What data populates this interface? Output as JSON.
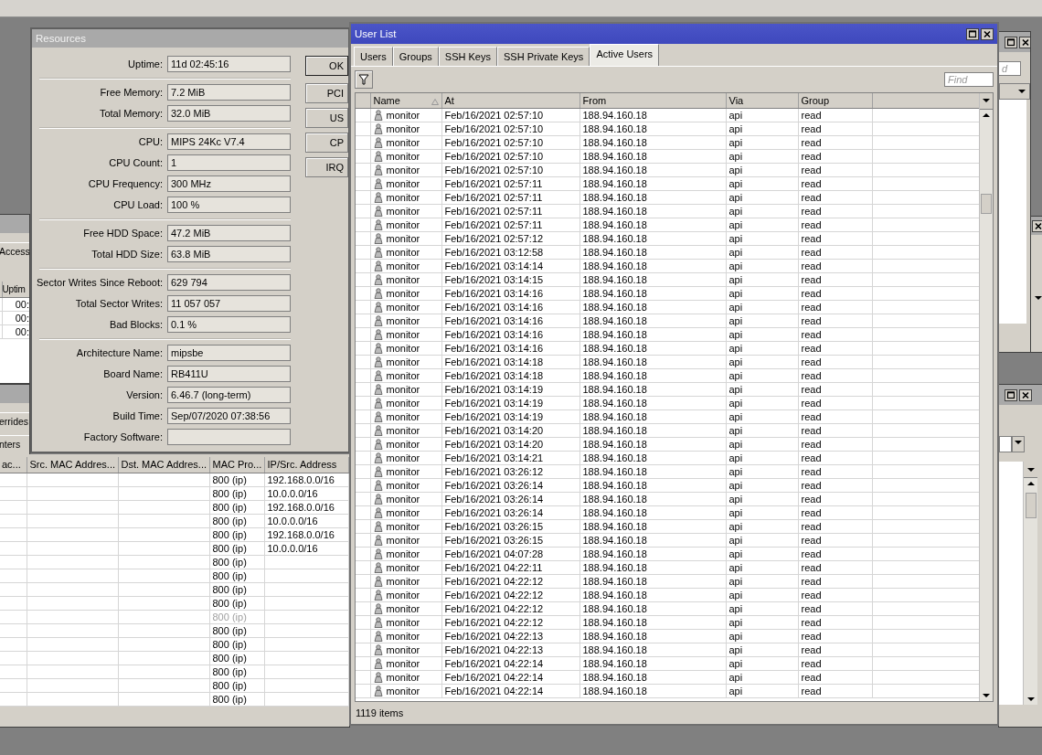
{
  "background_windows": {
    "left_top": {
      "tab": "Access",
      "column": "Uptim",
      "cells": [
        "00:",
        "00:",
        "00:"
      ]
    },
    "left_bottom": {
      "tabs": [
        "errides",
        "nters"
      ],
      "columns": [
        "ac...",
        "Src. MAC Addres...",
        "Dst. MAC Addres...",
        "MAC Pro...",
        "IP/Src. Address"
      ],
      "rows": [
        {
          "mac_protocol": "800 (ip)",
          "ip_src_address": "192.168.0.0/16",
          "disabled": false
        },
        {
          "mac_protocol": "800 (ip)",
          "ip_src_address": "10.0.0.0/16",
          "disabled": false
        },
        {
          "mac_protocol": "800 (ip)",
          "ip_src_address": "192.168.0.0/16",
          "disabled": false
        },
        {
          "mac_protocol": "800 (ip)",
          "ip_src_address": "10.0.0.0/16",
          "disabled": false
        },
        {
          "mac_protocol": "800 (ip)",
          "ip_src_address": "192.168.0.0/16",
          "disabled": false
        },
        {
          "mac_protocol": "800 (ip)",
          "ip_src_address": "10.0.0.0/16",
          "disabled": false
        },
        {
          "mac_protocol": "800 (ip)",
          "disabled": false
        },
        {
          "mac_protocol": "800 (ip)",
          "disabled": false
        },
        {
          "mac_protocol": "800 (ip)",
          "disabled": false
        },
        {
          "mac_protocol": "800 (ip)",
          "disabled": false
        },
        {
          "mac_protocol": "800 (ip)",
          "disabled": true
        },
        {
          "mac_protocol": "800 (ip)",
          "disabled": false
        },
        {
          "mac_protocol": "800 (ip)",
          "disabled": false
        },
        {
          "mac_protocol": "800 (ip)",
          "disabled": false
        },
        {
          "mac_protocol": "800 (ip)",
          "disabled": false
        },
        {
          "mac_protocol": "800 (ip)",
          "disabled": false
        },
        {
          "mac_protocol": "800 (ip)",
          "disabled": false
        }
      ]
    },
    "right_top": {
      "find_placeholder": "d"
    }
  },
  "resources": {
    "title": "Resources",
    "groups": [
      [
        {
          "label": "Uptime:",
          "value": "11d 02:45:16"
        }
      ],
      [
        {
          "label": "Free Memory:",
          "value": "7.2 MiB"
        },
        {
          "label": "Total Memory:",
          "value": "32.0 MiB"
        }
      ],
      [
        {
          "label": "CPU:",
          "value": "MIPS 24Kc V7.4"
        },
        {
          "label": "CPU Count:",
          "value": "1"
        },
        {
          "label": "CPU Frequency:",
          "value": "300 MHz"
        },
        {
          "label": "CPU Load:",
          "value": "100 %"
        }
      ],
      [
        {
          "label": "Free HDD Space:",
          "value": "47.2 MiB"
        },
        {
          "label": "Total HDD Size:",
          "value": "63.8 MiB"
        }
      ],
      [
        {
          "label": "Sector Writes Since Reboot:",
          "value": "629 794"
        },
        {
          "label": "Total Sector Writes:",
          "value": "11 057 057"
        },
        {
          "label": "Bad Blocks:",
          "value": "0.1 %"
        }
      ],
      [
        {
          "label": "Architecture Name:",
          "value": "mipsbe"
        },
        {
          "label": "Board Name:",
          "value": "RB411U"
        },
        {
          "label": "Version:",
          "value": "6.46.7 (long-term)"
        },
        {
          "label": "Build Time:",
          "value": "Sep/07/2020 07:38:56"
        },
        {
          "label": "Factory Software:"
        }
      ]
    ],
    "buttons": [
      "OK",
      "PCI",
      "US",
      "CP",
      "IRQ"
    ]
  },
  "user_list": {
    "title": "User List",
    "tabs": [
      {
        "label": "Users",
        "selected": false
      },
      {
        "label": "Groups",
        "selected": false
      },
      {
        "label": "SSH Keys",
        "selected": false
      },
      {
        "label": "SSH Private Keys",
        "selected": false
      },
      {
        "label": "Active Users",
        "selected": true
      }
    ],
    "find_placeholder": "Find",
    "columns": [
      "Name",
      "At",
      "From",
      "Via",
      "Group"
    ],
    "rows": [
      {
        "name": "monitor",
        "at": "Feb/16/2021 02:57:10",
        "from": "188.94.160.18",
        "via": "api",
        "group": "read"
      },
      {
        "name": "monitor",
        "at": "Feb/16/2021 02:57:10",
        "from": "188.94.160.18",
        "via": "api",
        "group": "read"
      },
      {
        "name": "monitor",
        "at": "Feb/16/2021 02:57:10",
        "from": "188.94.160.18",
        "via": "api",
        "group": "read"
      },
      {
        "name": "monitor",
        "at": "Feb/16/2021 02:57:10",
        "from": "188.94.160.18",
        "via": "api",
        "group": "read"
      },
      {
        "name": "monitor",
        "at": "Feb/16/2021 02:57:10",
        "from": "188.94.160.18",
        "via": "api",
        "group": "read"
      },
      {
        "name": "monitor",
        "at": "Feb/16/2021 02:57:11",
        "from": "188.94.160.18",
        "via": "api",
        "group": "read"
      },
      {
        "name": "monitor",
        "at": "Feb/16/2021 02:57:11",
        "from": "188.94.160.18",
        "via": "api",
        "group": "read"
      },
      {
        "name": "monitor",
        "at": "Feb/16/2021 02:57:11",
        "from": "188.94.160.18",
        "via": "api",
        "group": "read"
      },
      {
        "name": "monitor",
        "at": "Feb/16/2021 02:57:11",
        "from": "188.94.160.18",
        "via": "api",
        "group": "read"
      },
      {
        "name": "monitor",
        "at": "Feb/16/2021 02:57:12",
        "from": "188.94.160.18",
        "via": "api",
        "group": "read"
      },
      {
        "name": "monitor",
        "at": "Feb/16/2021 03:12:58",
        "from": "188.94.160.18",
        "via": "api",
        "group": "read"
      },
      {
        "name": "monitor",
        "at": "Feb/16/2021 03:14:14",
        "from": "188.94.160.18",
        "via": "api",
        "group": "read"
      },
      {
        "name": "monitor",
        "at": "Feb/16/2021 03:14:15",
        "from": "188.94.160.18",
        "via": "api",
        "group": "read"
      },
      {
        "name": "monitor",
        "at": "Feb/16/2021 03:14:16",
        "from": "188.94.160.18",
        "via": "api",
        "group": "read"
      },
      {
        "name": "monitor",
        "at": "Feb/16/2021 03:14:16",
        "from": "188.94.160.18",
        "via": "api",
        "group": "read"
      },
      {
        "name": "monitor",
        "at": "Feb/16/2021 03:14:16",
        "from": "188.94.160.18",
        "via": "api",
        "group": "read"
      },
      {
        "name": "monitor",
        "at": "Feb/16/2021 03:14:16",
        "from": "188.94.160.18",
        "via": "api",
        "group": "read"
      },
      {
        "name": "monitor",
        "at": "Feb/16/2021 03:14:16",
        "from": "188.94.160.18",
        "via": "api",
        "group": "read"
      },
      {
        "name": "monitor",
        "at": "Feb/16/2021 03:14:18",
        "from": "188.94.160.18",
        "via": "api",
        "group": "read"
      },
      {
        "name": "monitor",
        "at": "Feb/16/2021 03:14:18",
        "from": "188.94.160.18",
        "via": "api",
        "group": "read"
      },
      {
        "name": "monitor",
        "at": "Feb/16/2021 03:14:19",
        "from": "188.94.160.18",
        "via": "api",
        "group": "read"
      },
      {
        "name": "monitor",
        "at": "Feb/16/2021 03:14:19",
        "from": "188.94.160.18",
        "via": "api",
        "group": "read"
      },
      {
        "name": "monitor",
        "at": "Feb/16/2021 03:14:19",
        "from": "188.94.160.18",
        "via": "api",
        "group": "read"
      },
      {
        "name": "monitor",
        "at": "Feb/16/2021 03:14:20",
        "from": "188.94.160.18",
        "via": "api",
        "group": "read"
      },
      {
        "name": "monitor",
        "at": "Feb/16/2021 03:14:20",
        "from": "188.94.160.18",
        "via": "api",
        "group": "read"
      },
      {
        "name": "monitor",
        "at": "Feb/16/2021 03:14:21",
        "from": "188.94.160.18",
        "via": "api",
        "group": "read"
      },
      {
        "name": "monitor",
        "at": "Feb/16/2021 03:26:12",
        "from": "188.94.160.18",
        "via": "api",
        "group": "read"
      },
      {
        "name": "monitor",
        "at": "Feb/16/2021 03:26:14",
        "from": "188.94.160.18",
        "via": "api",
        "group": "read"
      },
      {
        "name": "monitor",
        "at": "Feb/16/2021 03:26:14",
        "from": "188.94.160.18",
        "via": "api",
        "group": "read"
      },
      {
        "name": "monitor",
        "at": "Feb/16/2021 03:26:14",
        "from": "188.94.160.18",
        "via": "api",
        "group": "read"
      },
      {
        "name": "monitor",
        "at": "Feb/16/2021 03:26:15",
        "from": "188.94.160.18",
        "via": "api",
        "group": "read"
      },
      {
        "name": "monitor",
        "at": "Feb/16/2021 03:26:15",
        "from": "188.94.160.18",
        "via": "api",
        "group": "read"
      },
      {
        "name": "monitor",
        "at": "Feb/16/2021 04:07:28",
        "from": "188.94.160.18",
        "via": "api",
        "group": "read"
      },
      {
        "name": "monitor",
        "at": "Feb/16/2021 04:22:11",
        "from": "188.94.160.18",
        "via": "api",
        "group": "read"
      },
      {
        "name": "monitor",
        "at": "Feb/16/2021 04:22:12",
        "from": "188.94.160.18",
        "via": "api",
        "group": "read"
      },
      {
        "name": "monitor",
        "at": "Feb/16/2021 04:22:12",
        "from": "188.94.160.18",
        "via": "api",
        "group": "read"
      },
      {
        "name": "monitor",
        "at": "Feb/16/2021 04:22:12",
        "from": "188.94.160.18",
        "via": "api",
        "group": "read"
      },
      {
        "name": "monitor",
        "at": "Feb/16/2021 04:22:12",
        "from": "188.94.160.18",
        "via": "api",
        "group": "read"
      },
      {
        "name": "monitor",
        "at": "Feb/16/2021 04:22:13",
        "from": "188.94.160.18",
        "via": "api",
        "group": "read"
      },
      {
        "name": "monitor",
        "at": "Feb/16/2021 04:22:13",
        "from": "188.94.160.18",
        "via": "api",
        "group": "read"
      },
      {
        "name": "monitor",
        "at": "Feb/16/2021 04:22:14",
        "from": "188.94.160.18",
        "via": "api",
        "group": "read"
      },
      {
        "name": "monitor",
        "at": "Feb/16/2021 04:22:14",
        "from": "188.94.160.18",
        "via": "api",
        "group": "read"
      },
      {
        "name": "monitor",
        "at": "Feb/16/2021 04:22:14",
        "from": "188.94.160.18",
        "via": "api",
        "group": "read"
      }
    ],
    "status": "1119 items"
  }
}
